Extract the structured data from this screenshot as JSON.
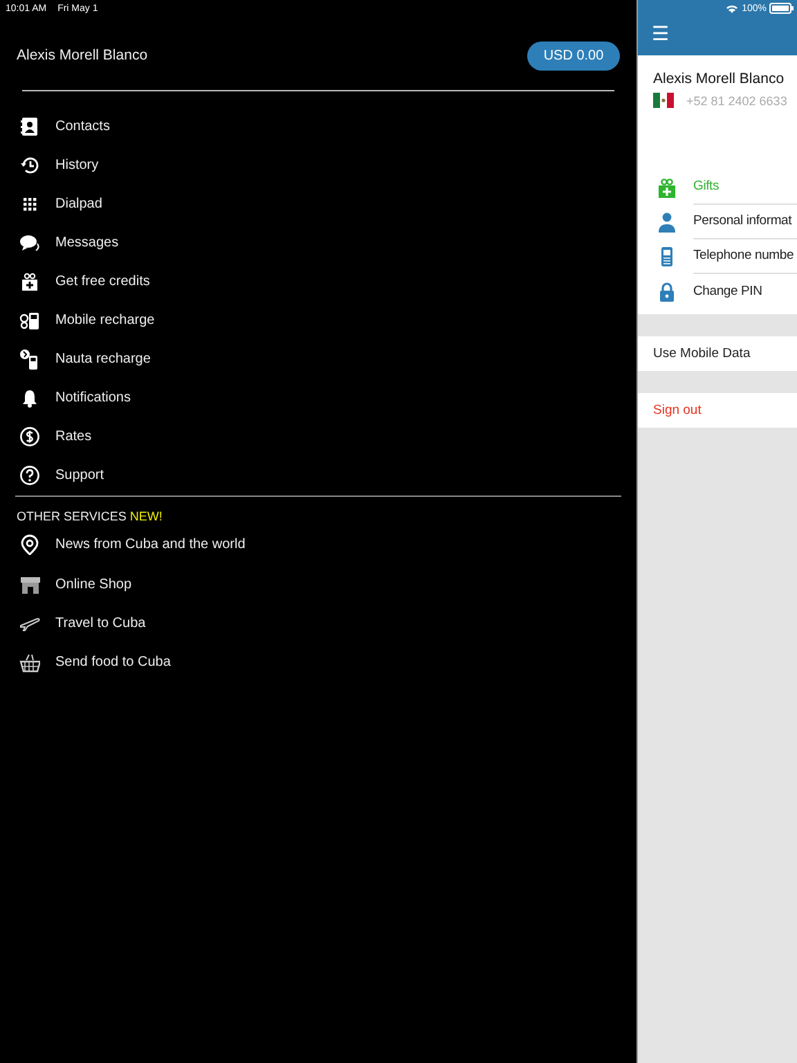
{
  "status_bar": {
    "time": "10:01 AM",
    "date": "Fri May 1",
    "battery": "100%"
  },
  "drawer": {
    "user_name": "Alexis Morell Blanco",
    "balance": "USD 0.00",
    "menu": [
      {
        "label": "Contacts"
      },
      {
        "label": "History"
      },
      {
        "label": "Dialpad"
      },
      {
        "label": "Messages"
      },
      {
        "label": "Get free credits"
      },
      {
        "label": "Mobile recharge"
      },
      {
        "label": "Nauta recharge"
      },
      {
        "label": "Notifications"
      },
      {
        "label": "Rates"
      },
      {
        "label": "Support"
      }
    ],
    "section": {
      "title": "OTHER SERVICES",
      "badge": "NEW!"
    },
    "services": [
      {
        "label": "News from Cuba and the world"
      },
      {
        "label": "Online Shop"
      },
      {
        "label": "Travel to Cuba"
      },
      {
        "label": "Send food to Cuba"
      }
    ]
  },
  "account": {
    "menu_icon": "☰",
    "user_name": "Alexis Morell Blanco",
    "phone": "+52 81 2402 6633",
    "items": [
      {
        "label": "Gifts",
        "highlighted": true
      },
      {
        "label": "Personal informat",
        "highlighted": false
      },
      {
        "label": "Telephone numbe",
        "highlighted": false
      },
      {
        "label": "Change PIN",
        "highlighted": false
      }
    ],
    "mobile_data": "Use Mobile Data",
    "sign_out": "Sign out"
  }
}
